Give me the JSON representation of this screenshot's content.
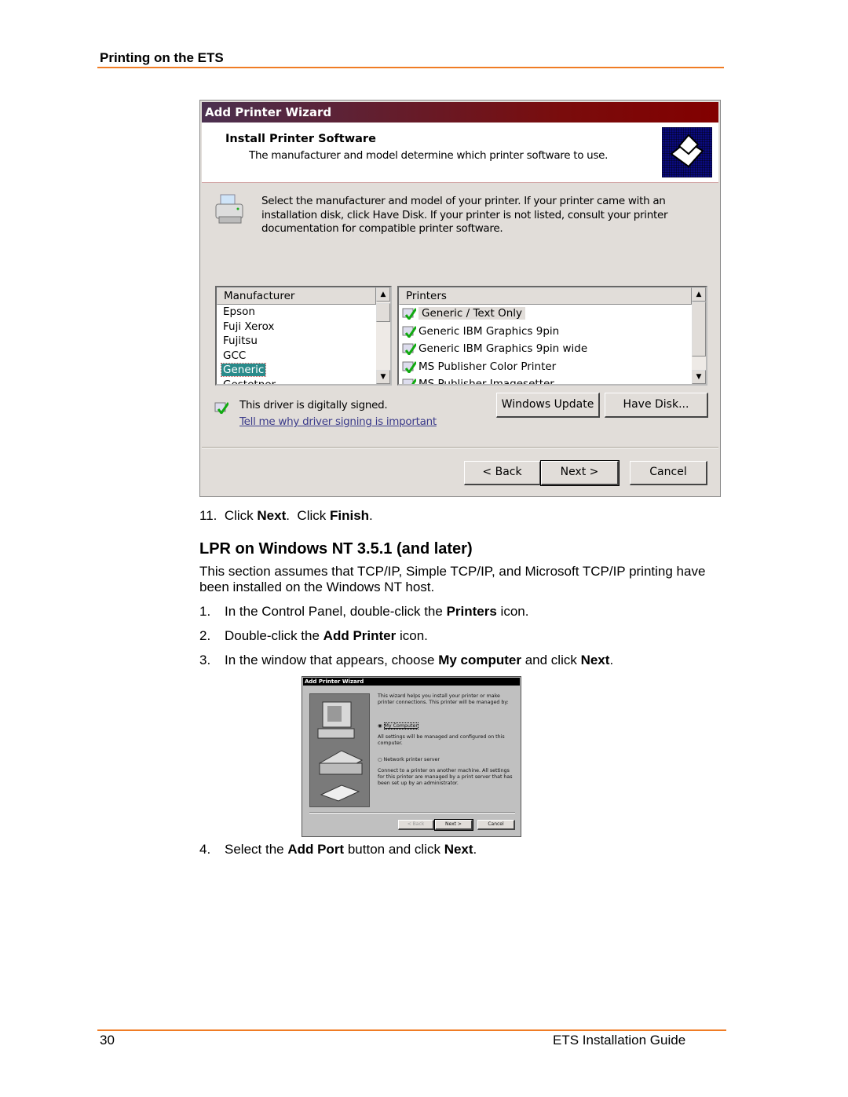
{
  "header": {
    "title": "Printing on the ETS"
  },
  "dialog1": {
    "title": "Add Printer Wizard",
    "heading": "Install Printer Software",
    "subheading": "The manufacturer and model determine which printer software to use.",
    "instructions": "Select the manufacturer and model of your printer. If your printer came with an installation disk, click Have Disk. If your printer is not listed, consult your printer documentation for compatible printer software.",
    "manufacturer_header": "Manufacturer",
    "manufacturers": [
      "Epson",
      "Fuji Xerox",
      "Fujitsu",
      "GCC",
      "Generic",
      "Gestetner"
    ],
    "selected_manufacturer": "Generic",
    "printers_header": "Printers",
    "printers": [
      "Generic / Text Only",
      "Generic IBM Graphics 9pin",
      "Generic IBM Graphics 9pin wide",
      "MS Publisher Color Printer",
      "MS Publisher Imagesetter"
    ],
    "selected_printer": "Generic / Text Only",
    "signed_text": "This driver is digitally signed.",
    "signing_link": "Tell me why driver signing is important",
    "windows_update": "Windows Update",
    "have_disk": "Have Disk...",
    "back": "< Back",
    "next": "Next >",
    "cancel": "Cancel",
    "colors": {
      "titlebar_start": "#4b3050",
      "titlebar_end": "#820000",
      "selection": "#2a8a8a",
      "link": "#3a3a8a"
    }
  },
  "step11": {
    "num": "11.",
    "pre": "Click ",
    "b1": "Next",
    "mid": ".  Click ",
    "b2": "Finish",
    "post": "."
  },
  "section": {
    "title": "LPR on Windows NT 3.5.1 (and later)",
    "intro": "This section assumes that TCP/IP, Simple TCP/IP, and Microsoft TCP/IP printing have been installed on the Windows NT host."
  },
  "steps": [
    {
      "num": "1.",
      "pre": "In the Control Panel, double-click the ",
      "bold": "Printers",
      "post": " icon."
    },
    {
      "num": "2.",
      "pre": "Double-click the ",
      "bold": "Add Printer",
      "post": " icon."
    },
    {
      "num": "3.",
      "pre": "In the window that appears, choose ",
      "bold": "My computer",
      "mid": " and click ",
      "bold2": "Next",
      "post": "."
    },
    {
      "num": "4.",
      "pre": "Select the ",
      "bold": "Add Port",
      "mid": " button and click ",
      "bold2": "Next",
      "post": "."
    }
  ],
  "dialog2": {
    "title": "Add Printer Wizard",
    "intro": "This wizard helps you install your printer or make printer connections.  This printer will be managed by:",
    "option1": "My Computer",
    "option1_desc": "All settings will be managed and configured on this computer.",
    "option2": "Network printer server",
    "option2_desc": "Connect to a printer on another machine.  All settings for this printer are managed by a print server that has been set up by an administrator.",
    "selected": "My Computer",
    "back": "< Back",
    "next": "Next >",
    "cancel": "Cancel"
  },
  "footer": {
    "page": "30",
    "guide": "ETS Installation Guide"
  }
}
